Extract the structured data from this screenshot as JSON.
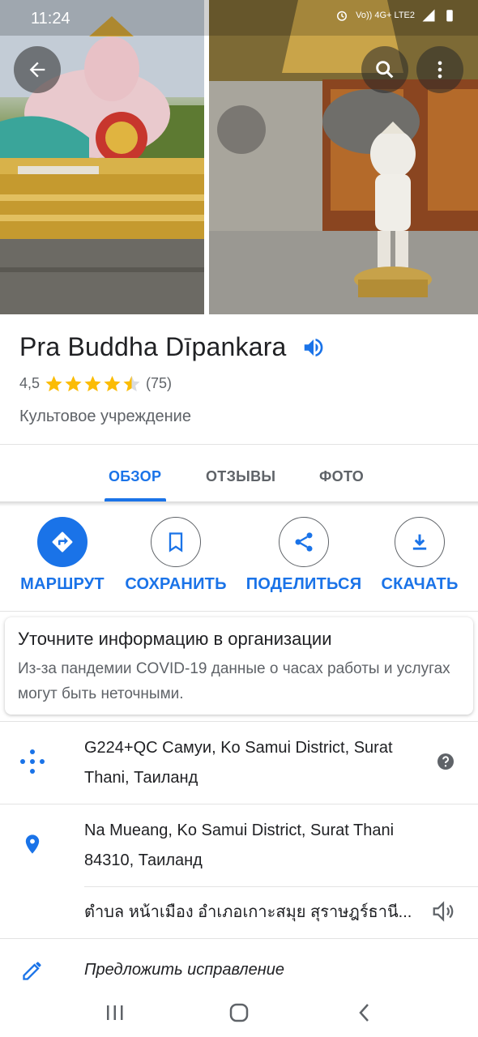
{
  "status_bar": {
    "time": "11:24",
    "network": "Vo)) 4G+ LTE2"
  },
  "header": {
    "back_icon": "arrow-back-icon",
    "search_icon": "search-icon",
    "more_icon": "more-vert-icon"
  },
  "place": {
    "title": "Pra Buddha Dīpankara",
    "rating": "4,5",
    "rating_value": 4.5,
    "rating_max": 5,
    "reviews_count": "(75)",
    "category": "Культовое учреждение"
  },
  "tabs": [
    {
      "label": "ОБЗОР",
      "active": true
    },
    {
      "label": "ОТЗЫВЫ",
      "active": false
    },
    {
      "label": "ФОТО",
      "active": false
    }
  ],
  "actions": [
    {
      "label": "МАРШРУТ",
      "icon": "directions-icon"
    },
    {
      "label": "СОХРАНИТЬ",
      "icon": "bookmark-icon"
    },
    {
      "label": "ПОДЕЛИТЬСЯ",
      "icon": "share-icon"
    },
    {
      "label": "СКАЧАТЬ",
      "icon": "download-icon"
    }
  ],
  "covid_card": {
    "title": "Уточните информацию в организации",
    "text": "Из-за пандемии COVID-19 данные о часах работы и услугах могут быть неточными."
  },
  "info": {
    "plus_code": "G224+QC Самуи, Ko Samui District, Surat Thani, Таиланд",
    "address": "Na Mueang, Ko Samui District, Surat Thani 84310, Таиланд",
    "address_local": "ตำบล หน้าเมือง อำเภอเกาะสมุย สุราษฎร์ธานี...",
    "suggest_edit": "Предложить исправление"
  },
  "colors": {
    "accent": "#1a73e8",
    "star": "#fbbc04",
    "secondary_text": "#5f6368"
  }
}
